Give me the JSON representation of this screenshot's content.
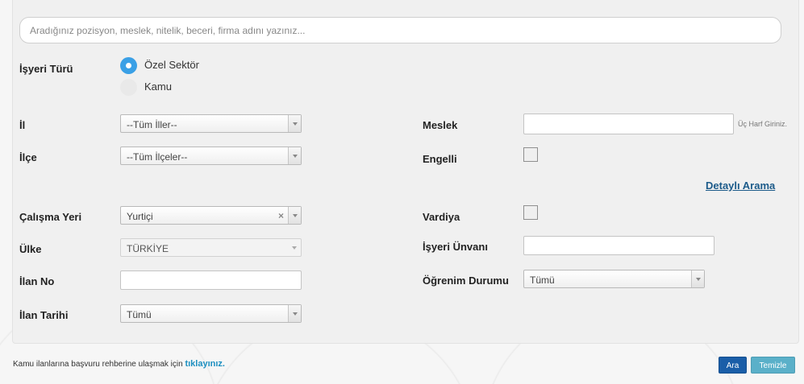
{
  "search": {
    "placeholder": "Aradığınız pozisyon, meslek, nitelik, beceri, firma adını yazınız..."
  },
  "sector": {
    "label": "İşyeri Türü",
    "options": [
      "Özel Sektör",
      "Kamu"
    ],
    "selected": "Özel Sektör"
  },
  "left_fields": {
    "il": {
      "label": "İl",
      "value": "--Tüm İller--"
    },
    "ilce": {
      "label": "İlçe",
      "value": "--Tüm İlçeler--"
    },
    "calisma_yeri": {
      "label": "Çalışma Yeri",
      "value": "Yurtiçi",
      "clear": "×"
    },
    "ulke": {
      "label": "Ülke",
      "value": "TÜRKİYE"
    },
    "ilan_no": {
      "label": "İlan No",
      "value": ""
    },
    "ilan_tarihi": {
      "label": "İlan Tarihi",
      "value": "Tümü"
    }
  },
  "right_fields": {
    "meslek": {
      "label": "Meslek",
      "value": "",
      "hint": "Üç Harf Giriniz."
    },
    "engelli": {
      "label": "Engelli",
      "checked": false
    },
    "detayli_arama": "Detaylı Arama",
    "vardiya": {
      "label": "Vardiya",
      "checked": false
    },
    "isyeri_unvani": {
      "label": "İşyeri Ünvanı",
      "value": ""
    },
    "ogrenim": {
      "label": "Öğrenim Durumu",
      "value": "Tümü"
    }
  },
  "footer": {
    "text": "Kamu ilanlarına başvuru rehberine ulaşmak için",
    "link": "tıklayınız."
  },
  "buttons": {
    "search": "Ara",
    "clear": "Temizle"
  },
  "colors": {
    "accent": "#3aa0e6",
    "primary_button": "#1a5ea8",
    "secondary_button": "#5ab0c9",
    "link": "#1c5b8a"
  }
}
